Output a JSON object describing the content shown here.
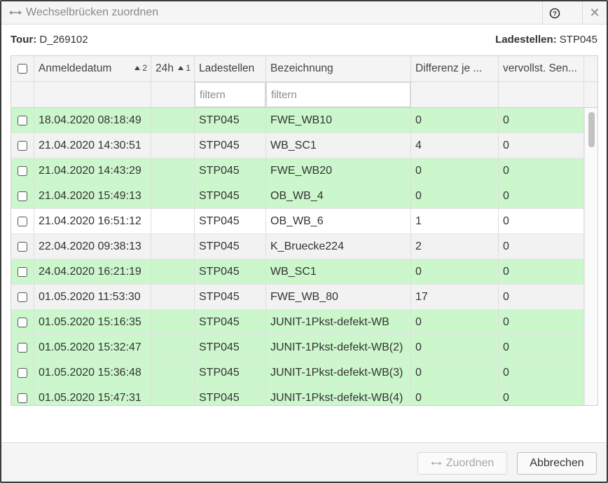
{
  "window": {
    "title": "Wechselbrücken zuordnen",
    "title_icon": "double-arrow-icon",
    "help_icon": "help-circle-icon",
    "close_label": "✕"
  },
  "info": {
    "tour_label": "Tour:",
    "tour_value": "D_269102",
    "ladestellen_label": "Ladestellen:",
    "ladestellen_value": "STP045"
  },
  "table": {
    "columns": [
      {
        "label": ""
      },
      {
        "label": "Anmeldedatum",
        "sort": "2"
      },
      {
        "label": "24h",
        "sort": "1"
      },
      {
        "label": "Ladestellen"
      },
      {
        "label": "Bezeichnung"
      },
      {
        "label": "Differenz je ..."
      },
      {
        "label": "vervollst. Sen..."
      }
    ],
    "filters": {
      "ladestellen_placeholder": "filtern",
      "bezeichnung_placeholder": "filtern"
    },
    "rows": [
      {
        "datum": "18.04.2020 08:18:49",
        "ladestelle": "STP045",
        "bezeichnung": "FWE_WB10",
        "differenz": "0",
        "vervollst": "0",
        "color": "green"
      },
      {
        "datum": "21.04.2020 14:30:51",
        "ladestelle": "STP045",
        "bezeichnung": "WB_SC1",
        "differenz": "4",
        "vervollst": "0",
        "color": "gray"
      },
      {
        "datum": "21.04.2020 14:43:29",
        "ladestelle": "STP045",
        "bezeichnung": "FWE_WB20",
        "differenz": "0",
        "vervollst": "0",
        "color": "green"
      },
      {
        "datum": "21.04.2020 15:49:13",
        "ladestelle": "STP045",
        "bezeichnung": "OB_WB_4",
        "differenz": "0",
        "vervollst": "0",
        "color": "green"
      },
      {
        "datum": "21.04.2020 16:51:12",
        "ladestelle": "STP045",
        "bezeichnung": "OB_WB_6",
        "differenz": "1",
        "vervollst": "0",
        "color": "white"
      },
      {
        "datum": "22.04.2020 09:38:13",
        "ladestelle": "STP045",
        "bezeichnung": "K_Bruecke224",
        "differenz": "2",
        "vervollst": "0",
        "color": "gray"
      },
      {
        "datum": "24.04.2020 16:21:19",
        "ladestelle": "STP045",
        "bezeichnung": "WB_SC1",
        "differenz": "0",
        "vervollst": "0",
        "color": "green"
      },
      {
        "datum": "01.05.2020 11:53:30",
        "ladestelle": "STP045",
        "bezeichnung": "FWE_WB_80",
        "differenz": "17",
        "vervollst": "0",
        "color": "gray"
      },
      {
        "datum": "01.05.2020 15:16:35",
        "ladestelle": "STP045",
        "bezeichnung": "JUNIT-1Pkst-defekt-WB",
        "differenz": "0",
        "vervollst": "0",
        "color": "green"
      },
      {
        "datum": "01.05.2020 15:32:47",
        "ladestelle": "STP045",
        "bezeichnung": "JUNIT-1Pkst-defekt-WB(2)",
        "differenz": "0",
        "vervollst": "0",
        "color": "green"
      },
      {
        "datum": "01.05.2020 15:36:48",
        "ladestelle": "STP045",
        "bezeichnung": "JUNIT-1Pkst-defekt-WB(3)",
        "differenz": "0",
        "vervollst": "0",
        "color": "green"
      },
      {
        "datum": "01.05.2020 15:47:31",
        "ladestelle": "STP045",
        "bezeichnung": "JUNIT-1Pkst-defekt-WB(4)",
        "differenz": "0",
        "vervollst": "0",
        "color": "green"
      }
    ]
  },
  "footer": {
    "assign_label": "Zuordnen",
    "cancel_label": "Abbrechen"
  },
  "colors": {
    "row_green": "#ccf7cc",
    "row_gray": "#f2f2f2",
    "row_white": "#ffffff"
  }
}
